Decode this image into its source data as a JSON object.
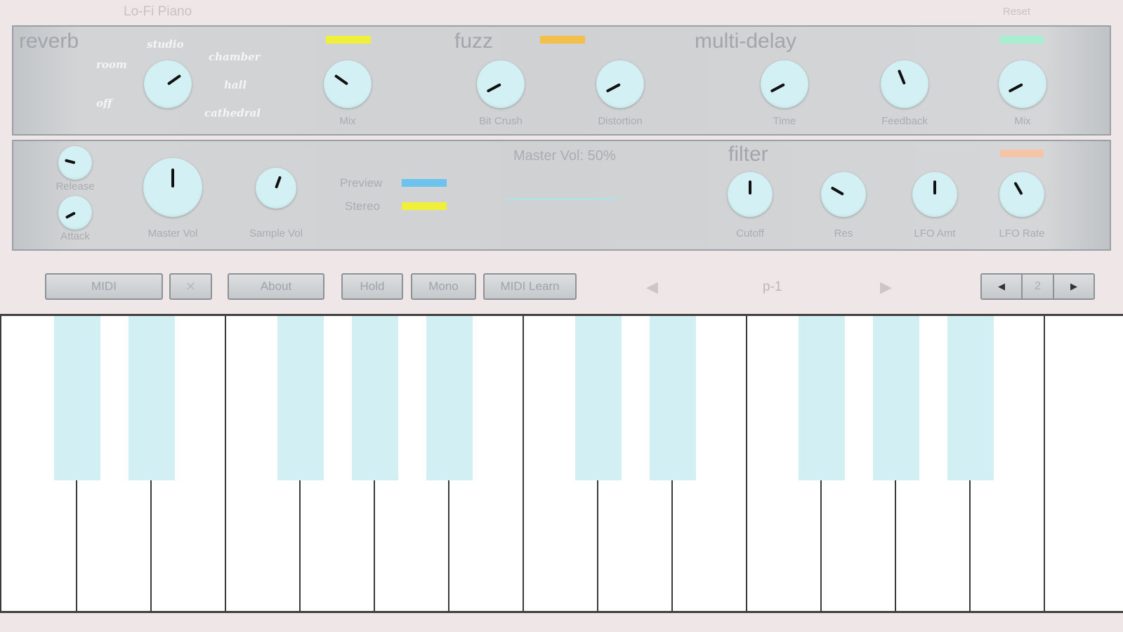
{
  "app": {
    "title": "Lo-Fi Piano",
    "reset_label": "Reset"
  },
  "colors": {
    "background": "#eee6e7",
    "knob": "#d3f1f4",
    "black_key": "#d2eff3",
    "reverb_indicator": "#f0f03a",
    "fuzz_indicator": "#f2c04a",
    "delay_indicator": "#a8eed0",
    "filter_indicator": "#f6c4a6",
    "preview_toggle": "#6cc3ee",
    "stereo_toggle": "#f0f03a"
  },
  "reverb": {
    "title": "reverb",
    "modes": [
      "off",
      "room",
      "studio",
      "chamber",
      "hall",
      "cathedral"
    ],
    "mix_label": "Mix"
  },
  "fuzz": {
    "title": "fuzz",
    "bitcrush_label": "Bit Crush",
    "distortion_label": "Distortion"
  },
  "delay": {
    "title": "multi-delay",
    "time_label": "Time",
    "feedback_label": "Feedback",
    "mix_label": "Mix"
  },
  "amp": {
    "release_label": "Release",
    "attack_label": "Attack",
    "master_label": "Master Vol",
    "sample_label": "Sample Vol",
    "preview_label": "Preview",
    "stereo_label": "Stereo",
    "master_readout": "Master Vol: 50%"
  },
  "filter": {
    "title": "filter",
    "cutoff_label": "Cutoff",
    "res_label": "Res",
    "lfo_amt_label": "LFO Amt",
    "lfo_rate_label": "LFO Rate"
  },
  "toolbar": {
    "midi": "MIDI",
    "close": "✕",
    "about": "About",
    "hold": "Hold",
    "mono": "Mono",
    "midi_learn": "MIDI Learn",
    "prev_preset": "◀",
    "preset_name": "p-1",
    "next_preset": "▶",
    "octave_down": "◀",
    "octave": "2",
    "octave_up": "▶"
  },
  "keyboard": {
    "white_keys": 15,
    "black_keys": 10
  }
}
